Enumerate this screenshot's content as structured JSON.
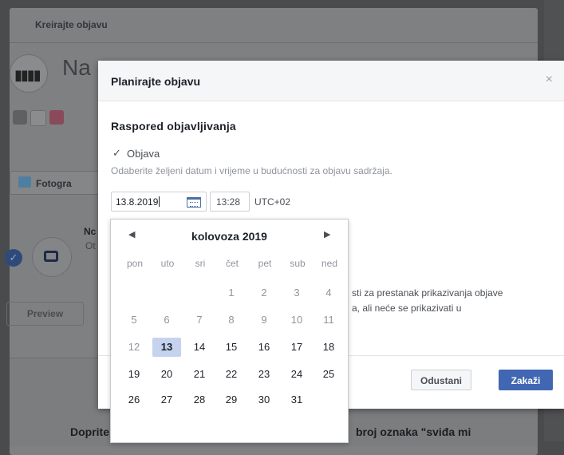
{
  "background": {
    "tab_label": "Kreirajte objavu",
    "page_name": "Na",
    "photo_button": "Fotogra",
    "item_title": "Nc",
    "item_sub": "Ot",
    "preview_label": "Preview",
    "bottom_left_text": "Doprite d",
    "bottom_right_text": "broj oznaka \"sviđa mi"
  },
  "dialog": {
    "title": "Planirajte objavu",
    "close_glyph": "×",
    "section_title": "Raspored objavljivanja",
    "post_checked_glyph": "✓",
    "post_label": "Objava",
    "help_text": "Odaberite željeni datum i vrijeme u budućnosti za objavu sadržaja.",
    "date_value": "13.8.2019",
    "time_value": "13:28",
    "timezone": "UTC+02",
    "hidden_line1": "sti za prestanak prikazivanja objave",
    "hidden_line2": "a, ali neće se prikazivati u",
    "cancel_label": "Odustani",
    "submit_label": "Zakaži"
  },
  "calendar": {
    "month_label": "kolovoza 2019",
    "prev_glyph": "◀",
    "next_glyph": "▶",
    "weekdays": [
      "pon",
      "uto",
      "sri",
      "čet",
      "pet",
      "sub",
      "ned"
    ],
    "weeks": [
      [
        "",
        "",
        "",
        "1",
        "2",
        "3",
        "4"
      ],
      [
        "5",
        "6",
        "7",
        "8",
        "9",
        "10",
        "11"
      ],
      [
        "12",
        "13",
        "14",
        "15",
        "16",
        "17",
        "18"
      ],
      [
        "19",
        "20",
        "21",
        "22",
        "23",
        "24",
        "25"
      ],
      [
        "26",
        "27",
        "28",
        "29",
        "30",
        "31",
        ""
      ]
    ],
    "selected_day": "13",
    "past_until_day": 12
  },
  "colors": {
    "accent": "#4267b2",
    "selected_day_bg": "#c5d3ee"
  }
}
